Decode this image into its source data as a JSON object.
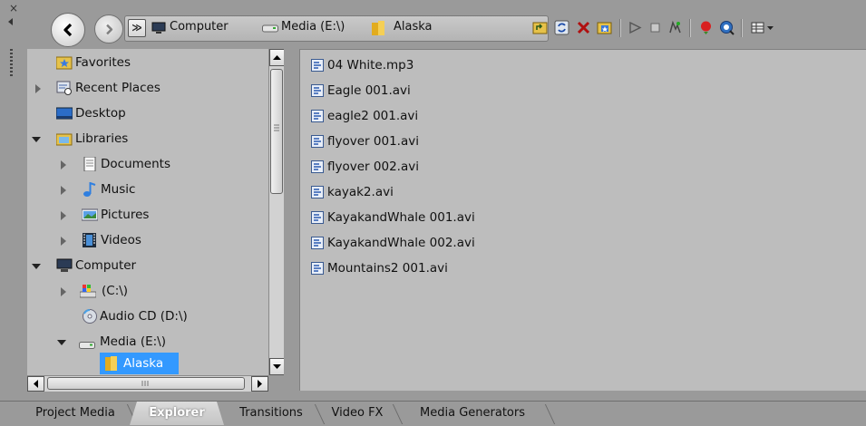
{
  "panel": {
    "close_glyph": "×"
  },
  "navigation": {
    "back_icon": "arrow-left-icon",
    "forward_icon": "arrow-right-icon",
    "history_glyph": "≫"
  },
  "address_bar": {
    "breadcrumbs": [
      "Computer",
      "Media (E:\\)",
      "Alaska"
    ]
  },
  "toolbar": {
    "icons": [
      "up-folder-icon",
      "refresh-icon",
      "delete-icon",
      "add-to-favorites-icon",
      "start-preview-icon",
      "stop-preview-icon",
      "auto-preview-icon",
      "get-media-icon",
      "search-icon",
      "views-icon"
    ]
  },
  "tree": {
    "items": [
      {
        "label": "Favorites"
      },
      {
        "label": "Recent Places"
      },
      {
        "label": "Desktop"
      },
      {
        "label": "Libraries"
      },
      {
        "label": "Documents"
      },
      {
        "label": "Music"
      },
      {
        "label": "Pictures"
      },
      {
        "label": "Videos"
      },
      {
        "label": "Computer"
      },
      {
        "label": "(C:\\)"
      },
      {
        "label": "Audio CD (D:\\)"
      },
      {
        "label": "Media (E:\\)"
      },
      {
        "label": "Alaska"
      }
    ],
    "selected": "Alaska"
  },
  "files": [
    "04 White.mp3",
    "Eagle 001.avi",
    "eagle2 001.avi",
    "flyover 001.avi",
    "flyover 002.avi",
    "kayak2.avi",
    "KayakandWhale 001.avi",
    "KayakandWhale 002.avi",
    "Mountains2 001.avi"
  ],
  "tabs": [
    {
      "label": "Project Media",
      "active": false
    },
    {
      "label": "Explorer",
      "active": true
    },
    {
      "label": "Transitions",
      "active": false
    },
    {
      "label": "Video FX",
      "active": false
    },
    {
      "label": "Media Generators",
      "active": false
    }
  ],
  "colors": {
    "background": "#9a9a9a",
    "pane": "#bdbdbd",
    "selection": "#3399ff"
  }
}
